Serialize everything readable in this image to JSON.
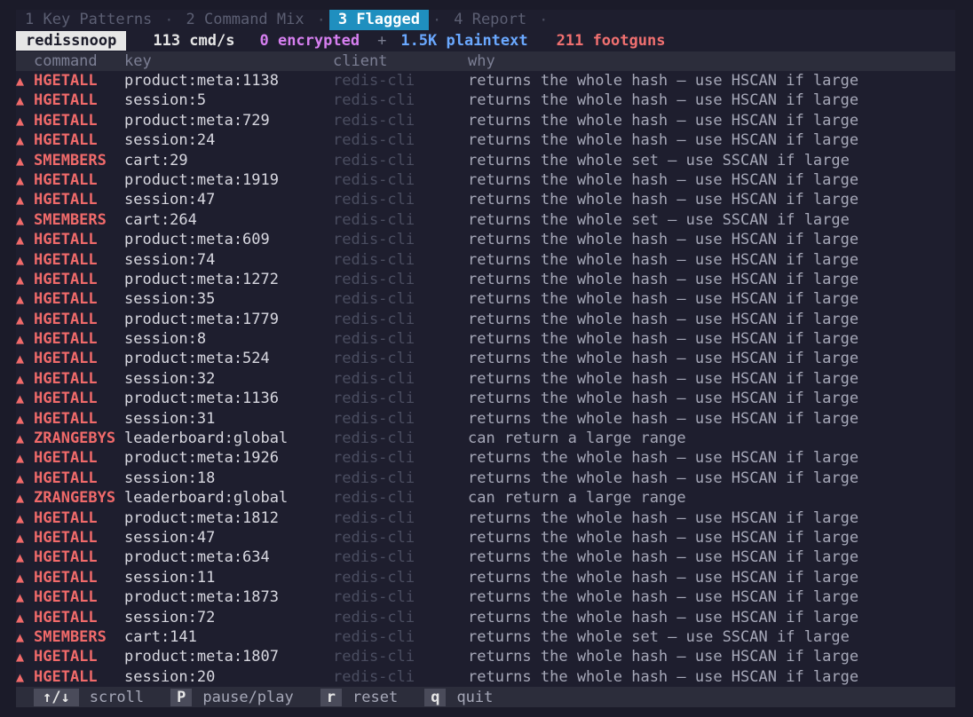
{
  "tabs": [
    {
      "label": "1 Key Patterns",
      "active": false
    },
    {
      "label": "2 Command Mix",
      "active": false
    },
    {
      "label": "3 Flagged",
      "active": true
    },
    {
      "label": "4 Report",
      "active": false
    }
  ],
  "tab_separator": "·",
  "stats": {
    "app_name": "redissnoop",
    "cmds": "113 cmd/s",
    "encrypted": "0 encrypted",
    "plus": "+",
    "plaintext": "1.5K plaintext",
    "footguns": "211 footguns"
  },
  "table": {
    "headers": {
      "command": "command",
      "key": "key",
      "client": "client",
      "why": "why"
    },
    "warn_glyph": "▲",
    "rows": [
      {
        "command": "HGETALL",
        "key": "product:meta:1138",
        "client": "redis-cli",
        "why": "returns the whole hash — use HSCAN if large"
      },
      {
        "command": "HGETALL",
        "key": "session:5",
        "client": "redis-cli",
        "why": "returns the whole hash — use HSCAN if large"
      },
      {
        "command": "HGETALL",
        "key": "product:meta:729",
        "client": "redis-cli",
        "why": "returns the whole hash — use HSCAN if large"
      },
      {
        "command": "HGETALL",
        "key": "session:24",
        "client": "redis-cli",
        "why": "returns the whole hash — use HSCAN if large"
      },
      {
        "command": "SMEMBERS",
        "key": "cart:29",
        "client": "redis-cli",
        "why": "returns the whole set — use SSCAN if large"
      },
      {
        "command": "HGETALL",
        "key": "product:meta:1919",
        "client": "redis-cli",
        "why": "returns the whole hash — use HSCAN if large"
      },
      {
        "command": "HGETALL",
        "key": "session:47",
        "client": "redis-cli",
        "why": "returns the whole hash — use HSCAN if large"
      },
      {
        "command": "SMEMBERS",
        "key": "cart:264",
        "client": "redis-cli",
        "why": "returns the whole set — use SSCAN if large"
      },
      {
        "command": "HGETALL",
        "key": "product:meta:609",
        "client": "redis-cli",
        "why": "returns the whole hash — use HSCAN if large"
      },
      {
        "command": "HGETALL",
        "key": "session:74",
        "client": "redis-cli",
        "why": "returns the whole hash — use HSCAN if large"
      },
      {
        "command": "HGETALL",
        "key": "product:meta:1272",
        "client": "redis-cli",
        "why": "returns the whole hash — use HSCAN if large"
      },
      {
        "command": "HGETALL",
        "key": "session:35",
        "client": "redis-cli",
        "why": "returns the whole hash — use HSCAN if large"
      },
      {
        "command": "HGETALL",
        "key": "product:meta:1779",
        "client": "redis-cli",
        "why": "returns the whole hash — use HSCAN if large"
      },
      {
        "command": "HGETALL",
        "key": "session:8",
        "client": "redis-cli",
        "why": "returns the whole hash — use HSCAN if large"
      },
      {
        "command": "HGETALL",
        "key": "product:meta:524",
        "client": "redis-cli",
        "why": "returns the whole hash — use HSCAN if large"
      },
      {
        "command": "HGETALL",
        "key": "session:32",
        "client": "redis-cli",
        "why": "returns the whole hash — use HSCAN if large"
      },
      {
        "command": "HGETALL",
        "key": "product:meta:1136",
        "client": "redis-cli",
        "why": "returns the whole hash — use HSCAN if large"
      },
      {
        "command": "HGETALL",
        "key": "session:31",
        "client": "redis-cli",
        "why": "returns the whole hash — use HSCAN if large"
      },
      {
        "command": "ZRANGEBYS",
        "key": "leaderboard:global",
        "client": "redis-cli",
        "why": "can return a large range"
      },
      {
        "command": "HGETALL",
        "key": "product:meta:1926",
        "client": "redis-cli",
        "why": "returns the whole hash — use HSCAN if large"
      },
      {
        "command": "HGETALL",
        "key": "session:18",
        "client": "redis-cli",
        "why": "returns the whole hash — use HSCAN if large"
      },
      {
        "command": "ZRANGEBYS",
        "key": "leaderboard:global",
        "client": "redis-cli",
        "why": "can return a large range"
      },
      {
        "command": "HGETALL",
        "key": "product:meta:1812",
        "client": "redis-cli",
        "why": "returns the whole hash — use HSCAN if large"
      },
      {
        "command": "HGETALL",
        "key": "session:47",
        "client": "redis-cli",
        "why": "returns the whole hash — use HSCAN if large"
      },
      {
        "command": "HGETALL",
        "key": "product:meta:634",
        "client": "redis-cli",
        "why": "returns the whole hash — use HSCAN if large"
      },
      {
        "command": "HGETALL",
        "key": "session:11",
        "client": "redis-cli",
        "why": "returns the whole hash — use HSCAN if large"
      },
      {
        "command": "HGETALL",
        "key": "product:meta:1873",
        "client": "redis-cli",
        "why": "returns the whole hash — use HSCAN if large"
      },
      {
        "command": "HGETALL",
        "key": "session:72",
        "client": "redis-cli",
        "why": "returns the whole hash — use HSCAN if large"
      },
      {
        "command": "SMEMBERS",
        "key": "cart:141",
        "client": "redis-cli",
        "why": "returns the whole set — use SSCAN if large"
      },
      {
        "command": "HGETALL",
        "key": "product:meta:1807",
        "client": "redis-cli",
        "why": "returns the whole hash — use HSCAN if large"
      },
      {
        "command": "HGETALL",
        "key": "session:20",
        "client": "redis-cli",
        "why": "returns the whole hash — use HSCAN if large"
      }
    ]
  },
  "footer": {
    "keys": [
      {
        "key": "↑/↓",
        "label": "scroll"
      },
      {
        "key": "P",
        "label": "pause/play"
      },
      {
        "key": "r",
        "label": "reset"
      },
      {
        "key": "q",
        "label": "quit"
      }
    ]
  },
  "colors": {
    "background": "#1e1e2e",
    "active_tab": "#1f8fbf",
    "footgun": "#f06a6a",
    "encrypted": "#d67ff0",
    "plaintext": "#6aa8ff"
  }
}
